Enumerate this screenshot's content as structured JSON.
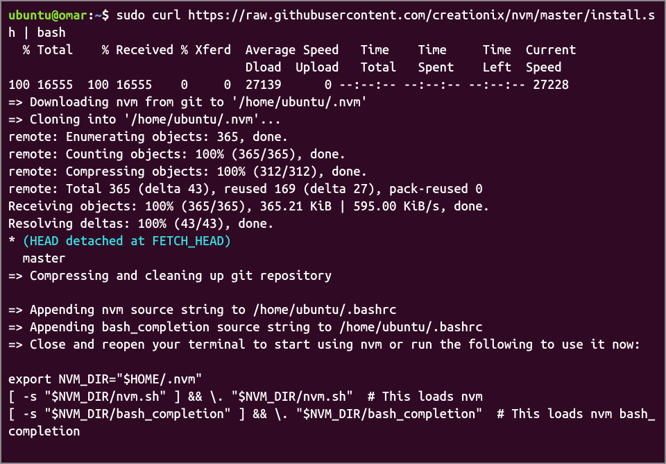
{
  "prompt": {
    "user": "ubuntu",
    "at": "@",
    "host": "omar",
    "colon": ":",
    "path": "~",
    "dollar": "$",
    "command": " sudo curl https://raw.githubusercontent.com/creationix/nvm/master/install.sh | bash"
  },
  "lines": {
    "l1": "  % Total    % Received % Xferd  Average Speed   Time    Time     Time  Current",
    "l2": "                                 Dload  Upload   Total   Spent    Left  Speed",
    "l3": "100 16555  100 16555    0     0  27139      0 --:--:-- --:--:-- --:--:-- 27228",
    "l4": "=> Downloading nvm from git to '/home/ubuntu/.nvm'",
    "l5": "=> Cloning into '/home/ubuntu/.nvm'...",
    "l6": "remote: Enumerating objects: 365, done.",
    "l7": "remote: Counting objects: 100% (365/365), done.",
    "l8": "remote: Compressing objects: 100% (312/312), done.",
    "l9": "remote: Total 365 (delta 43), reused 169 (delta 27), pack-reused 0",
    "l10": "Receiving objects: 100% (365/365), 365.21 KiB | 595.00 KiB/s, done.",
    "l11": "Resolving deltas: 100% (43/43), done.",
    "l12star": "* ",
    "l12head": "(HEAD detached at FETCH_HEAD)",
    "l13": "  master",
    "l14": "=> Compressing and cleaning up git repository",
    "l15": "",
    "l16": "=> Appending nvm source string to /home/ubuntu/.bashrc",
    "l17": "=> Appending bash_completion source string to /home/ubuntu/.bashrc",
    "l18": "=> Close and reopen your terminal to start using nvm or run the following to use it now:",
    "l19": "",
    "l20": "export NVM_DIR=\"$HOME/.nvm\"",
    "l21": "[ -s \"$NVM_DIR/nvm.sh\" ] && \\. \"$NVM_DIR/nvm.sh\"  # This loads nvm",
    "l22": "[ -s \"$NVM_DIR/bash_completion\" ] && \\. \"$NVM_DIR/bash_completion\"  # This loads nvm bash_completion"
  }
}
